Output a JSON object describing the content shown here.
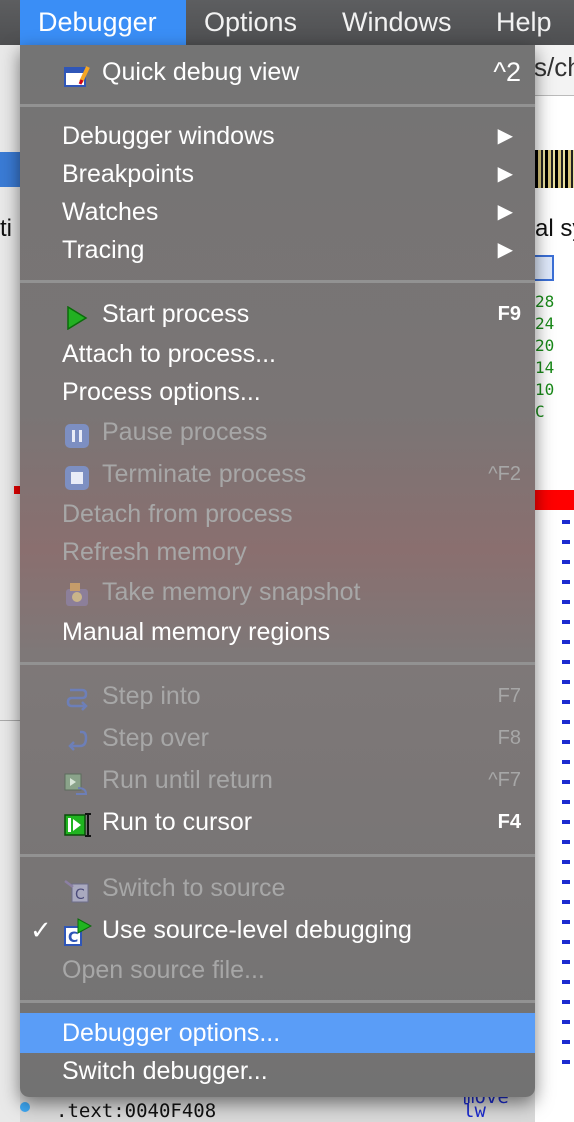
{
  "background": {
    "tab_text": "s/ch",
    "left_text": "ti",
    "right_text": "al sy",
    "hex": [
      "28",
      "24",
      "20",
      "14",
      "10",
      "C"
    ],
    "bottom_addr": ".text:0040F408",
    "bottom_instr": "lw",
    "bottom_instr_prev": "move"
  },
  "menubar": {
    "items": [
      "Debugger",
      "Options",
      "Windows",
      "Help"
    ],
    "active": "Debugger"
  },
  "menu": {
    "quick_debug_view": {
      "label": "Quick debug view",
      "shortcut": "^2"
    },
    "debugger_windows": "Debugger windows",
    "breakpoints": "Breakpoints",
    "watches": "Watches",
    "tracing": "Tracing",
    "start_process": {
      "label": "Start process",
      "shortcut": "F9"
    },
    "attach_to_process": "Attach to process...",
    "process_options": "Process options...",
    "pause_process": "Pause process",
    "terminate_process": {
      "label": "Terminate process",
      "shortcut": "^F2"
    },
    "detach_from_process": "Detach from process",
    "refresh_memory": "Refresh memory",
    "take_memory_snapshot": "Take memory snapshot",
    "manual_memory_regions": "Manual memory regions",
    "step_into": {
      "label": "Step into",
      "shortcut": "F7"
    },
    "step_over": {
      "label": "Step over",
      "shortcut": "F8"
    },
    "run_until_return": {
      "label": "Run until return",
      "shortcut": "^F7"
    },
    "run_to_cursor": {
      "label": "Run to cursor",
      "shortcut": "F4"
    },
    "switch_to_source": "Switch to source",
    "use_source_level_debugging": {
      "label": "Use source-level debugging",
      "checkmark": "✓"
    },
    "open_source_file": "Open source file...",
    "debugger_options": "Debugger options...",
    "switch_debugger": "Switch debugger...",
    "submenu_arrow": "▶"
  },
  "colors": {
    "highlight": "#5a9df7",
    "menubar_active": "#3a8ef6",
    "disabled_text": "#a7a7a7"
  }
}
